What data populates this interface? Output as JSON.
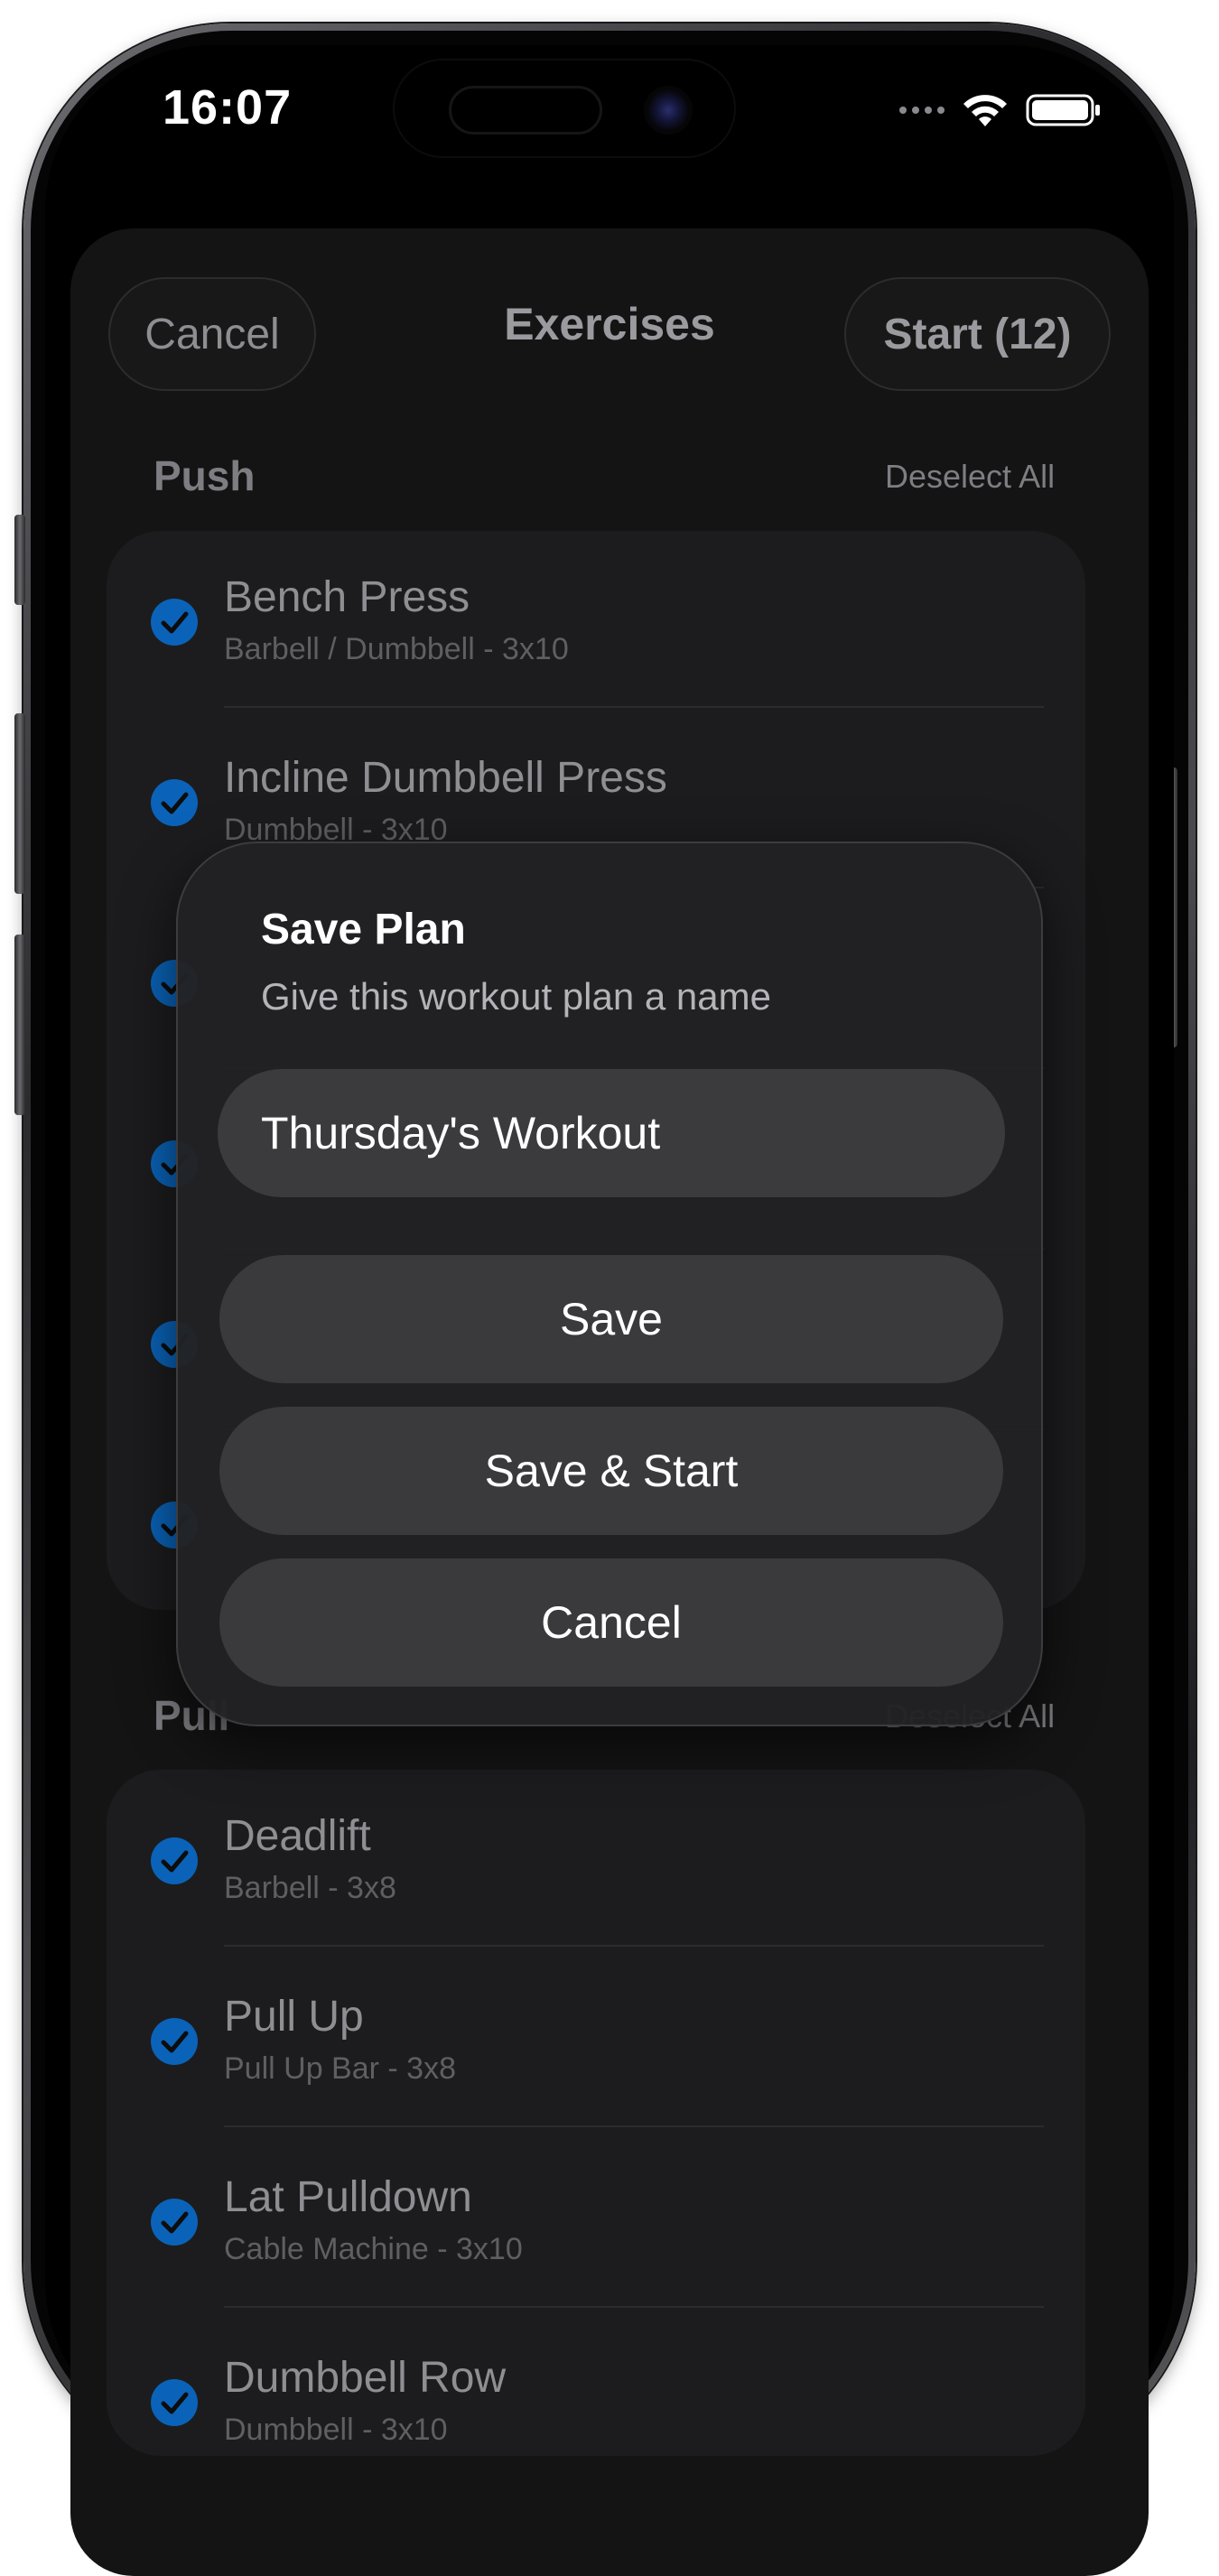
{
  "status_bar": {
    "time": "16:07"
  },
  "nav": {
    "cancel_label": "Cancel",
    "title": "Exercises",
    "start_label": "Start (12)"
  },
  "sections": [
    {
      "title": "Push",
      "action": "Deselect All",
      "items": [
        {
          "name": "Bench Press",
          "detail": "Barbell / Dumbbell - 3x10",
          "checked": true
        },
        {
          "name": "Incline Dumbbell Press",
          "detail": "Dumbbell - 3x10",
          "checked": true
        }
      ]
    },
    {
      "title": "Pull",
      "action": "Deselect All",
      "items": [
        {
          "name": "Deadlift",
          "detail": "Barbell - 3x8",
          "checked": true
        },
        {
          "name": "Pull Up",
          "detail": "Pull Up Bar - 3x8",
          "checked": true
        },
        {
          "name": "Lat Pulldown",
          "detail": "Cable Machine - 3x10",
          "checked": true
        },
        {
          "name": "Dumbbell Row",
          "detail": "Dumbbell - 3x10",
          "checked": true
        }
      ]
    }
  ],
  "modal": {
    "title": "Save Plan",
    "subtitle": "Give this workout plan a name",
    "input_value": "Thursday's Workout",
    "save_label": "Save",
    "save_start_label": "Save & Start",
    "cancel_label": "Cancel"
  },
  "colors": {
    "accent_check": "#0a63b8",
    "background": "#000000",
    "card": "#1c1c1e",
    "modal": "#222224",
    "modal_button": "#3a3a3c"
  }
}
